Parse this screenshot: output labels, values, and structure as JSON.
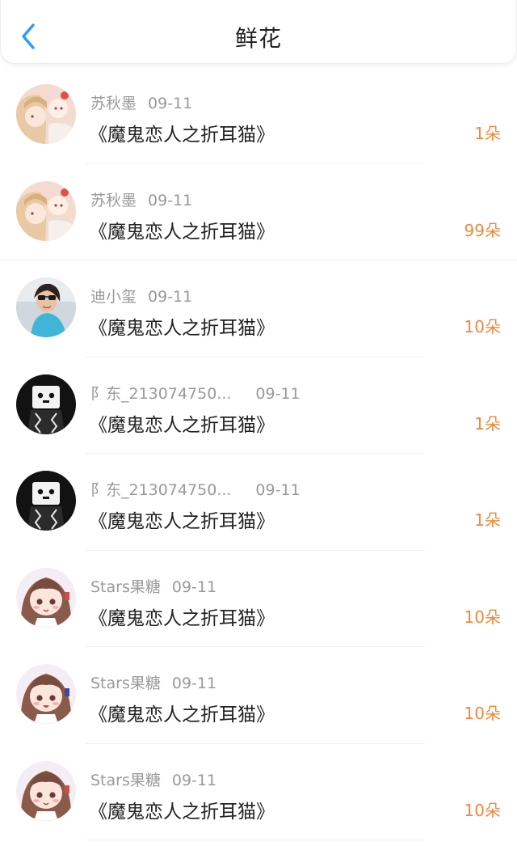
{
  "header": {
    "title": "鲜花",
    "back_icon": "chevron-left-icon",
    "accent": "#2a9df4"
  },
  "colors": {
    "count": "#f0883a",
    "meta": "#9a9a9a"
  },
  "records": [
    {
      "user": "苏秋墨",
      "date": "09-11",
      "book": "《魔鬼恋人之折耳猫》",
      "count": "1朵",
      "avatar": "anime-girls-avatar"
    },
    {
      "user": "苏秋墨",
      "date": "09-11",
      "book": "《魔鬼恋人之折耳猫》",
      "count": "99朵",
      "avatar": "anime-girls-avatar"
    },
    {
      "user": "迪小玺",
      "date": "09-11",
      "book": "《魔鬼恋人之折耳猫》",
      "count": "10朵",
      "avatar": "selfie-avatar"
    },
    {
      "user": "阝东_213074750...",
      "date": "09-11",
      "book": "《魔鬼恋人之折耳猫》",
      "count": "1朵",
      "avatar": "box-character-avatar"
    },
    {
      "user": "阝东_213074750...",
      "date": "09-11",
      "book": "《魔鬼恋人之折耳猫》",
      "count": "1朵",
      "avatar": "box-character-avatar"
    },
    {
      "user": "Stars果糖",
      "date": "09-11",
      "book": "《魔鬼恋人之折耳猫》",
      "count": "10朵",
      "avatar": "chibi-girl-avatar"
    },
    {
      "user": "Stars果糖",
      "date": "09-11",
      "book": "《魔鬼恋人之折耳猫》",
      "count": "10朵",
      "avatar": "chibi-girl-avatar"
    },
    {
      "user": "Stars果糖",
      "date": "09-11",
      "book": "《魔鬼恋人之折耳猫》",
      "count": "10朵",
      "avatar": "chibi-girl-avatar"
    }
  ]
}
